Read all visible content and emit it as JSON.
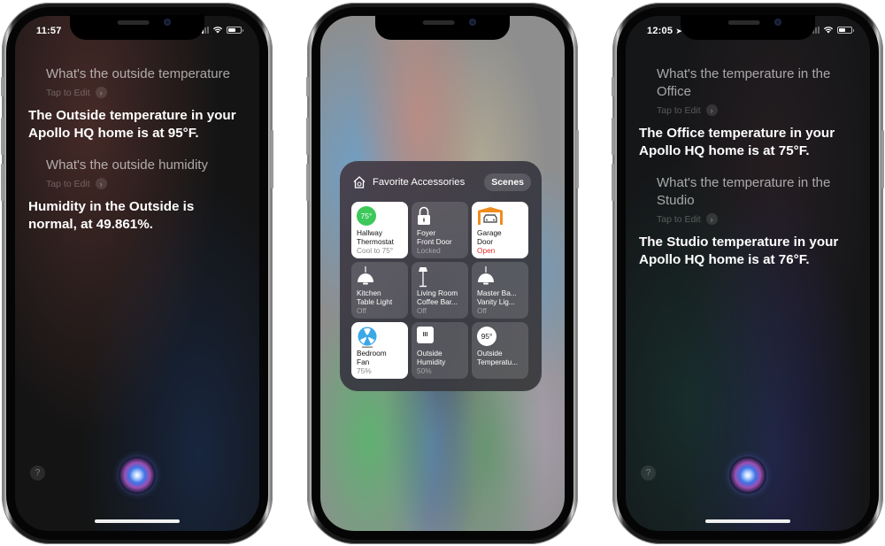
{
  "phones": [
    {
      "status_bar": {
        "time": "11:57",
        "location_arrow": false
      },
      "conversation": [
        {
          "query": "What's the outside temperature",
          "edit_hint": "Tap to Edit",
          "answer": "The Outside temperature in your Apollo HQ home is at 95°F."
        },
        {
          "query": "What's the outside humidity",
          "edit_hint": "Tap to Edit",
          "answer": "Humidity in the Outside is normal, at 49.861%."
        }
      ],
      "help_label": "?"
    },
    {
      "panel": {
        "title": "Favorite Accessories",
        "scenes_label": "Scenes",
        "tiles": [
          {
            "name_line1": "Hallway",
            "name_line2": "Thermostat",
            "state": "Cool to 75°",
            "badge": "75°",
            "icon": "thermostat-icon",
            "active": true
          },
          {
            "name_line1": "Foyer",
            "name_line2": "Front Door",
            "state": "Locked",
            "icon": "lock-icon",
            "active": false
          },
          {
            "name_line1": "Garage",
            "name_line2": "Door",
            "state": "Open",
            "icon": "garage-door-icon",
            "active": true,
            "state_color": "#e0312a"
          },
          {
            "name_line1": "Kitchen",
            "name_line2": "Table Light",
            "state": "Off",
            "icon": "pendant-lamp-icon",
            "active": false
          },
          {
            "name_line1": "Living Room",
            "name_line2": "Coffee Bar...",
            "state": "Off",
            "icon": "floor-lamp-icon",
            "active": false
          },
          {
            "name_line1": "Master Ba...",
            "name_line2": "Vanity Lig...",
            "state": "Off",
            "icon": "pendant-lamp-icon",
            "active": false
          },
          {
            "name_line1": "Bedroom",
            "name_line2": "Fan",
            "state": "75%",
            "icon": "fan-icon",
            "active": true
          },
          {
            "name_line1": "Outside",
            "name_line2": "Humidity",
            "state": "50%",
            "badge": "III",
            "icon": "humidity-sensor-icon",
            "active": false
          },
          {
            "name_line1": "Outside",
            "name_line2": "Temperatu...",
            "state": "",
            "badge": "95°",
            "icon": "temperature-sensor-icon",
            "active": false
          }
        ]
      }
    },
    {
      "status_bar": {
        "time": "12:05",
        "location_arrow": true
      },
      "conversation": [
        {
          "query": "What's the temperature in the Office",
          "edit_hint": "Tap to Edit",
          "answer": "The Office temperature in your Apollo HQ home is at 75°F."
        },
        {
          "query": "What's the temperature in the Studio",
          "edit_hint": "Tap to Edit",
          "answer": "The Studio temperature in your Apollo HQ home is at 76°F."
        }
      ],
      "help_label": "?"
    }
  ],
  "colors": {
    "thermostat_green": "#3cc85a",
    "garage_orange": "#f08c1e",
    "fan_blue": "#3aa8e8",
    "alert_red": "#e0312a"
  }
}
